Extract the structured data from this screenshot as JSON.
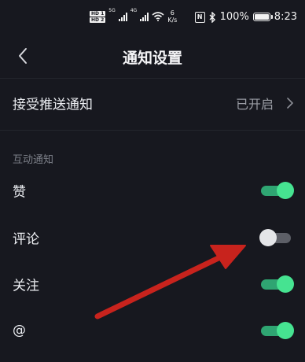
{
  "status_bar": {
    "hd1": "HD 1",
    "hd2": "HD 2",
    "net1": "5G",
    "net2": "4G",
    "speed_value": "6",
    "speed_unit": "K/s",
    "nfc": "N",
    "battery_pct": "100%",
    "time": "8:23"
  },
  "header": {
    "title": "通知设置"
  },
  "push": {
    "label": "接受推送通知",
    "value": "已开启"
  },
  "section": {
    "title": "互动通知"
  },
  "items": [
    {
      "label": "赞",
      "on": true
    },
    {
      "label": "评论",
      "on": false
    },
    {
      "label": "关注",
      "on": true
    },
    {
      "label": "@",
      "on": true
    }
  ],
  "colors": {
    "background": "#17181f",
    "toggle_on": "#46e391",
    "toggle_off": "#e4e5e8",
    "annotation_arrow": "#c8231d"
  }
}
